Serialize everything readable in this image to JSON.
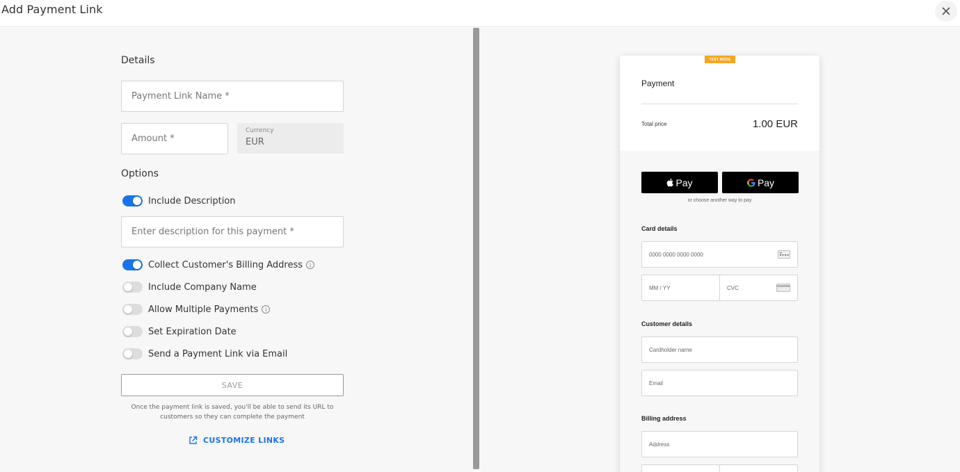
{
  "header": {
    "title": "Add Payment Link"
  },
  "details": {
    "section_title": "Details",
    "name_placeholder": "Payment Link Name *",
    "amount_placeholder": "Amount *",
    "currency_label": "Currency",
    "currency_value": "EUR"
  },
  "options": {
    "section_title": "Options",
    "toggles": [
      {
        "label": "Include Description",
        "on": true
      },
      {
        "label": "Collect Customer's Billing Address",
        "on": true,
        "info": true
      },
      {
        "label": "Include Company Name",
        "on": false
      },
      {
        "label": "Allow Multiple Payments",
        "on": false,
        "info": true
      },
      {
        "label": "Set Expiration Date",
        "on": false
      },
      {
        "label": "Send a Payment Link via Email",
        "on": false
      }
    ],
    "description_placeholder": "Enter description for this payment *"
  },
  "actions": {
    "save_label": "SAVE",
    "save_note": "Once the payment link is saved, you'll be able to send its URL to customers so they can complete the payment",
    "customize_label": "CUSTOMIZE LINKS"
  },
  "preview": {
    "badge": "TEST MODE",
    "title": "Payment",
    "total_label": "Total price",
    "total_value": "1.00 EUR",
    "apple_pay": "Pay",
    "google_pay": "Pay",
    "or_text": "or choose another way to pay",
    "card_details_label": "Card details",
    "card_number_placeholder": "0000 0000 0000 0000",
    "expiry_placeholder": "MM / YY",
    "cvc_placeholder": "CVC",
    "customer_details_label": "Customer details",
    "cardholder_placeholder": "Cardholder name",
    "email_placeholder": "Email",
    "billing_address_label": "Billing address",
    "address_placeholder": "Address"
  },
  "colors": {
    "accent": "#1a73e8",
    "badge": "#f5a623"
  }
}
